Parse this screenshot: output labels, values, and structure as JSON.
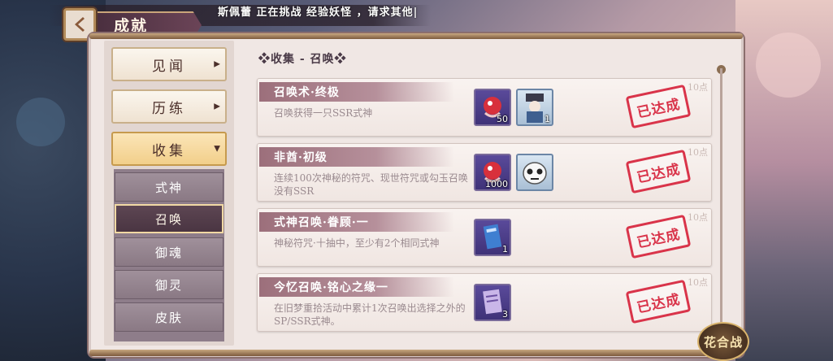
{
  "header": {
    "title": "成就",
    "announcement": "斯佩蕾 正在挑战 经验妖怪 ，请求其他|"
  },
  "sidebar": {
    "tabs": [
      {
        "label": "见闻",
        "state": "collapsed"
      },
      {
        "label": "历练",
        "state": "collapsed"
      },
      {
        "label": "收集",
        "state": "expanded"
      }
    ],
    "sub_items": [
      {
        "label": "式神"
      },
      {
        "label": "召唤"
      },
      {
        "label": "御魂"
      },
      {
        "label": "御灵"
      },
      {
        "label": "皮肤"
      }
    ],
    "selected_sub_item": "召唤"
  },
  "content": {
    "section_title": "❖收集 - 召唤❖",
    "achievements": [
      {
        "title": "召唤术·终极",
        "description": "召唤获得一只SSR式神",
        "points": "10点",
        "status": "已达成",
        "rewards": [
          {
            "icon": "red-daruma-icon",
            "count": "50"
          },
          {
            "icon": "shikigami-portrait-icon",
            "count": "1"
          }
        ]
      },
      {
        "title": "非酋·初级",
        "description": "连续100次神秘的符咒、现世符咒或勾玉召唤没有SSR",
        "points": "10点",
        "status": "已达成",
        "rewards": [
          {
            "icon": "red-daruma-icon",
            "count": "1000"
          },
          {
            "icon": "pale-mask-avatar-icon",
            "count": ""
          }
        ]
      },
      {
        "title": "式神召唤·眷顾·一",
        "description": "神秘符咒·十抽中，至少有2个相同式神",
        "points": "10点",
        "status": "已达成",
        "rewards": [
          {
            "icon": "blue-talisman-icon",
            "count": "1"
          }
        ]
      },
      {
        "title": "今忆召唤·铭心之缘一",
        "description": "在旧梦重拾活动中累计1次召唤出选择之外的SP/SSR式神。",
        "points": "10点",
        "status": "已达成",
        "rewards": [
          {
            "icon": "purple-scroll-icon",
            "count": "3"
          }
        ]
      }
    ]
  },
  "corner_emblem": {
    "label": "花合战"
  }
}
